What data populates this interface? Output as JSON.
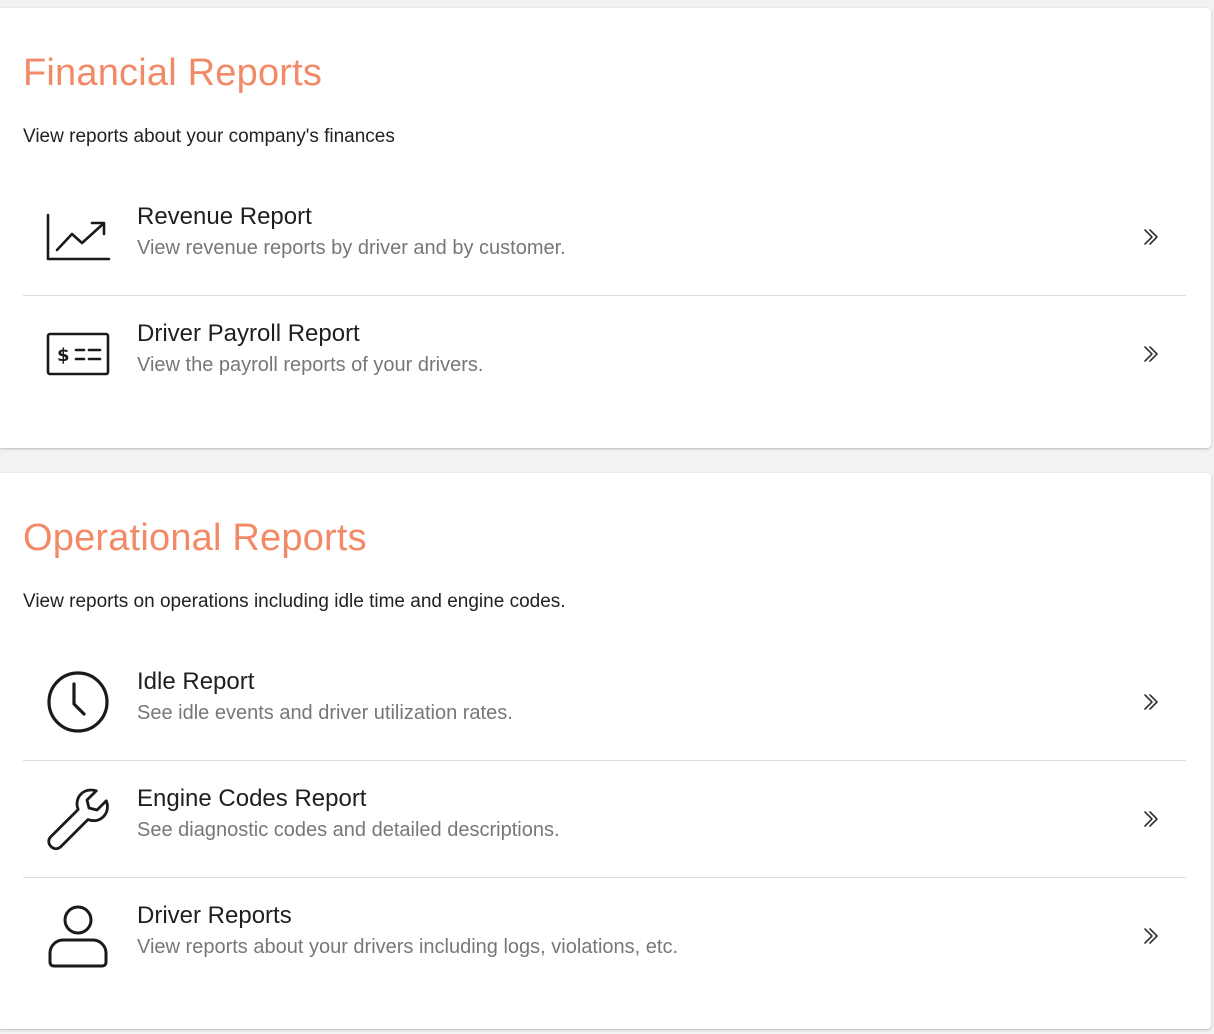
{
  "financial": {
    "title": "Financial Reports",
    "description": "View reports about your company's finances",
    "items": [
      {
        "name": "Revenue Report",
        "description": "View revenue reports by driver and by customer.",
        "icon": "trend-chart-icon"
      },
      {
        "name": "Driver Payroll Report",
        "description": "View the payroll reports of your drivers.",
        "icon": "paycheck-icon"
      }
    ]
  },
  "operational": {
    "title": "Operational Reports",
    "description": "View reports on operations including idle time and engine codes.",
    "items": [
      {
        "name": "Idle Report",
        "description": "See idle events and driver utilization rates.",
        "icon": "clock-icon"
      },
      {
        "name": "Engine Codes Report",
        "description": "See diagnostic codes and detailed descriptions.",
        "icon": "wrench-icon"
      },
      {
        "name": "Driver Reports",
        "description": "View reports about your drivers including logs, violations, etc.",
        "icon": "person-icon"
      }
    ]
  },
  "colors": {
    "heading": "#f28a67",
    "page_bg": "#f2f2f2",
    "card_bg": "#ffffff",
    "secondary_text": "#777777"
  }
}
